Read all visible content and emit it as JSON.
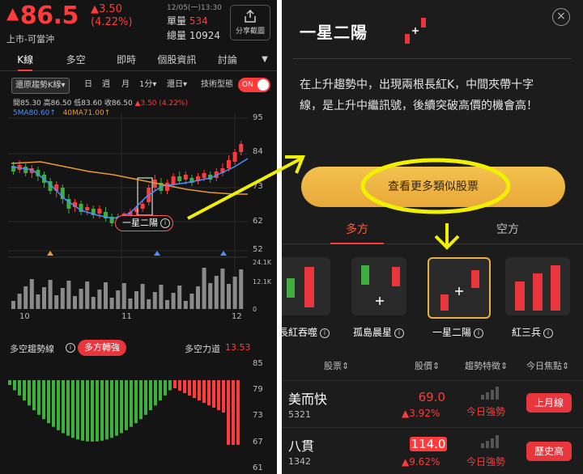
{
  "left": {
    "price": "86.5",
    "change": "3.50",
    "change_pct": "(4.22%)",
    "market": "上市-可當沖",
    "date": "12/05(一)13:30",
    "volume_label": "單量",
    "volume_value": "534",
    "total_label": "總量",
    "total_value": "10924",
    "share_label": "分享截圖",
    "tabs": [
      "K線",
      "多空",
      "即時",
      "個股資訊",
      "討論"
    ],
    "toolbar": {
      "restore": "還原趨勢K線▾",
      "day": "日",
      "week": "週",
      "month": "月",
      "minute": "1分▾",
      "reset": "還日▾",
      "tech": "技術型態",
      "toggle": "ON"
    },
    "ohlc": {
      "open": "開85.30",
      "high": "高86.50",
      "low": "低83.60",
      "close": "收86.50",
      "chg": "▲3.50 (4.22%)",
      "ma5": "5MA80.60↑",
      "ma40": "40MA71.00↑"
    },
    "price_axis": [
      "95",
      "84",
      "73",
      "62",
      "52"
    ],
    "vol_axis": [
      "24.1K",
      "12.1K",
      "0"
    ],
    "x_axis": [
      "10",
      "11",
      "12"
    ],
    "pattern_tag": "一星二陽",
    "trend": {
      "label": "多空趨勢線",
      "badge": "多方轉強",
      "force_label": "多空力道",
      "force_value": "13.53"
    },
    "trend_axis": [
      "85",
      "79",
      "73",
      "67",
      "61"
    ]
  },
  "right": {
    "title": "一星二陽",
    "close": "×",
    "description": "在上升趨勢中，出現兩根長紅K，中間夾帶十字線，是上升中繼訊號，後續突破高價的機會高！",
    "more_button": "查看更多類似股票",
    "tabs": [
      "多方",
      "空方"
    ],
    "patterns": [
      "長紅吞噬",
      "孤島晨星",
      "一星二陽",
      "紅三兵"
    ],
    "table_headers": [
      "股票",
      "股價",
      "趨勢特徵",
      "今日焦點"
    ],
    "rows": [
      {
        "name": "美而快",
        "code": "5321",
        "price": "69.0",
        "chg": "▲3.92%",
        "trend": "今日強勢",
        "focus": "上月線"
      },
      {
        "name": "八貫",
        "code": "1342",
        "price": "114.0",
        "chg": "▲9.62%",
        "trend": "今日強勢",
        "focus": "歷史高"
      }
    ]
  },
  "colors": {
    "up": "#ff3b3b",
    "down": "#3fae3f",
    "accent": "#e9b04a",
    "annotation": "#f0f000",
    "ma5": "#4a90ff",
    "ma40": "#e89a30"
  }
}
